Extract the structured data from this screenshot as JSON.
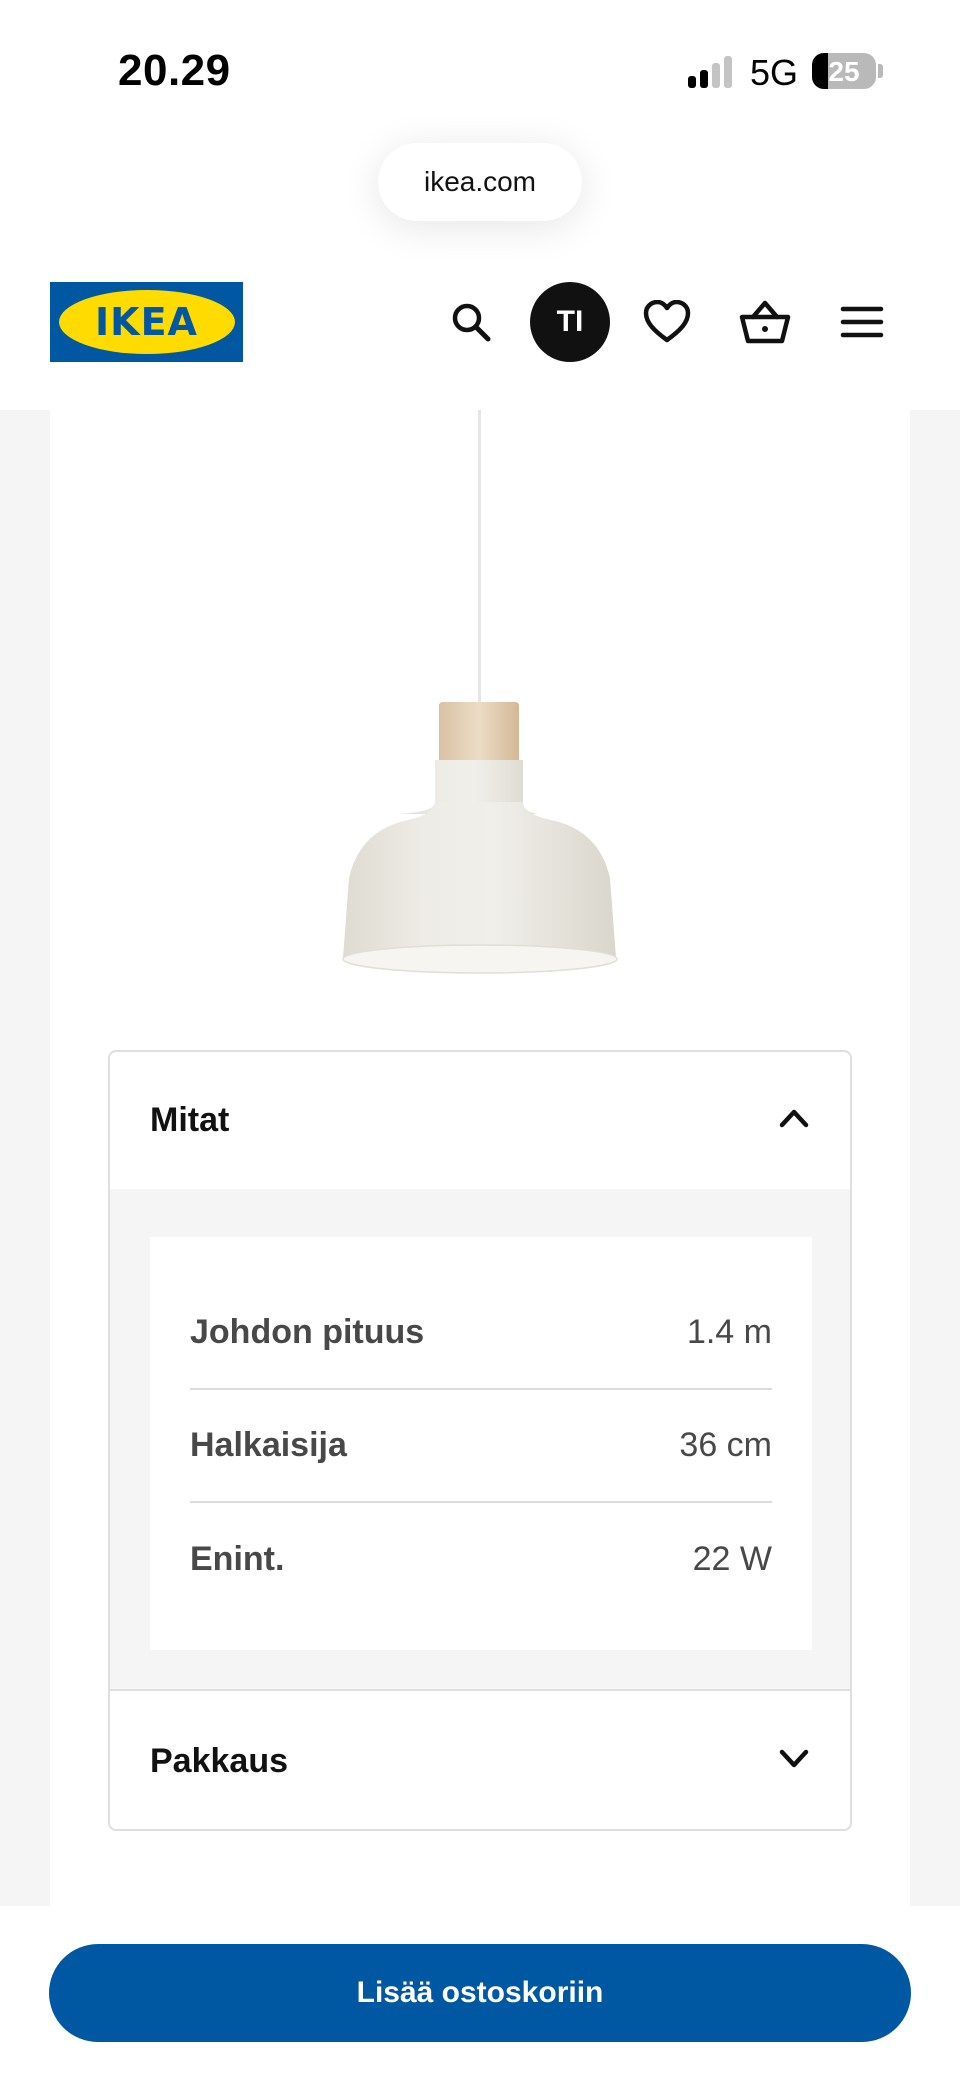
{
  "status_bar": {
    "time": "20.29",
    "network": "5G",
    "battery": "25",
    "battery_level": 0.25,
    "signal_bars_active": 2,
    "signal_bars_total": 4
  },
  "browser": {
    "url": "ikea.com"
  },
  "header": {
    "logo_text": "IKEA",
    "avatar_initials": "TI",
    "icons": [
      "search-icon",
      "heart-icon",
      "shopping-basket-icon",
      "menu-icon"
    ]
  },
  "colors": {
    "brand_blue": "#0058a3",
    "brand_yellow": "#ffdb00",
    "background_gray": "#f5f5f5"
  },
  "product": {
    "image": "pendant-lamp-image"
  },
  "accordion": {
    "dimensions": {
      "title": "Mitat",
      "expanded": true,
      "rows": [
        {
          "label": "Johdon pituus",
          "value": "1.4 m"
        },
        {
          "label": "Halkaisija",
          "value": "36 cm"
        },
        {
          "label": "Enint.",
          "value": "22 W"
        }
      ]
    },
    "package": {
      "title": "Pakkaus",
      "expanded": false
    }
  },
  "cta": {
    "label": "Lisää ostoskoriin"
  }
}
